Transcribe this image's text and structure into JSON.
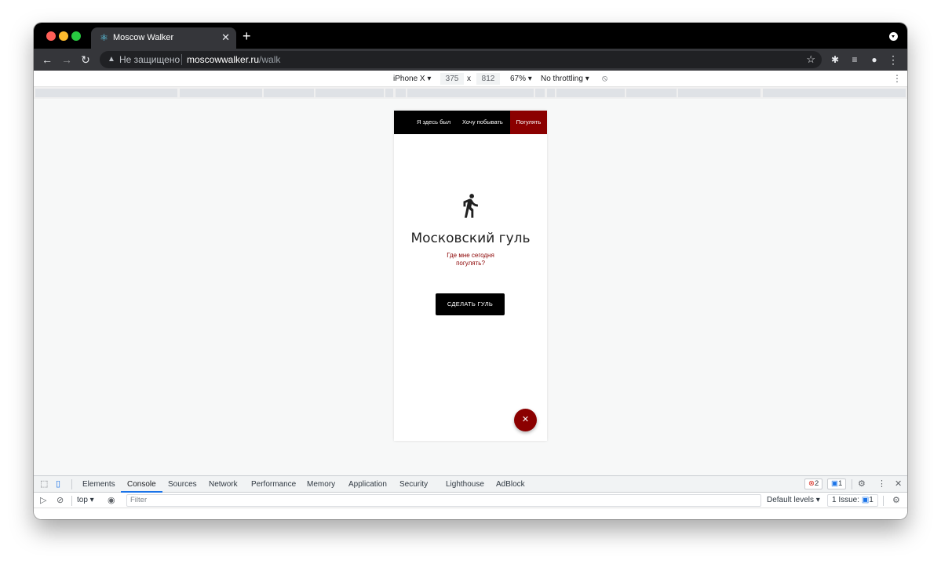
{
  "browser": {
    "tab_title": "Moscow Walker",
    "tab_close": "✕",
    "new_tab": "+",
    "security_text": "Не защищено",
    "url_host": "moscowwalker.ru",
    "url_path": "/walk"
  },
  "device_toolbar": {
    "device": "iPhone X ▾",
    "width": "375",
    "times": "x",
    "height": "812",
    "zoom": "67% ▾",
    "throttling": "No throttling ▾"
  },
  "app": {
    "nav": {
      "been_here": "Я здесь был",
      "want_visit": "Хочу побывать",
      "walk": "Погулять"
    },
    "title": "Московский гуль",
    "subtitle": "Где мне сегодня погулять?",
    "main_button": "СДЕЛАТЬ ГУЛЬ",
    "fab_label": "✕"
  },
  "devtools": {
    "tabs": [
      "Elements",
      "Console",
      "Sources",
      "Network",
      "Performance",
      "Memory",
      "Application",
      "Security",
      "Lighthouse",
      "AdBlock"
    ],
    "active_tab": "Console",
    "error_count": "2",
    "message_count": "1",
    "context": "top ▾",
    "filter_placeholder": "Filter",
    "levels": "Default levels ▾",
    "issues_label": "1 Issue:",
    "issues_count": "1"
  },
  "colors": {
    "accent_red": "#8b0000",
    "nav_black": "#000000"
  }
}
